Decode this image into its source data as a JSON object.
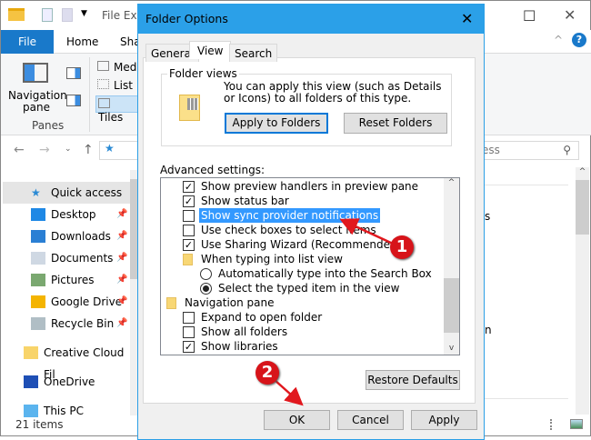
{
  "explorer": {
    "title": "File Exp",
    "ribbon_tabs": [
      "File",
      "Home",
      "Sha"
    ],
    "layout_items": [
      "Med",
      "List",
      "Tiles"
    ],
    "navigation_pane_label": "Navigation pane",
    "panes_label": "Panes",
    "search_placeholder": "ess",
    "nav_items": [
      {
        "label": "Quick access",
        "icon": "star-icon"
      },
      {
        "label": "Desktop",
        "icon": "desktop-icon",
        "pinned": true
      },
      {
        "label": "Downloads",
        "icon": "download-icon",
        "pinned": true
      },
      {
        "label": "Documents",
        "icon": "documents-icon",
        "pinned": true
      },
      {
        "label": "Pictures",
        "icon": "pictures-icon",
        "pinned": true
      },
      {
        "label": "Google Drive",
        "icon": "google-drive-icon",
        "pinned": true
      },
      {
        "label": "Recycle Bin",
        "icon": "recycle-bin-icon",
        "pinned": true
      },
      {
        "label": "Creative Cloud Fil",
        "icon": "creative-cloud-icon"
      },
      {
        "label": "OneDrive",
        "icon": "onedrive-icon"
      },
      {
        "label": "This PC",
        "icon": "pc-icon"
      }
    ],
    "content_fragments": [
      "s",
      "n"
    ],
    "status": "21 items"
  },
  "dialog": {
    "title": "Folder Options",
    "tabs": [
      "General",
      "View",
      "Search"
    ],
    "active_tab": "View",
    "folder_views": {
      "legend": "Folder views",
      "description": "You can apply this view (such as Details or Icons) to all folders of this type.",
      "apply_button": "Apply to Folders",
      "reset_button": "Reset Folders"
    },
    "advanced_label": "Advanced settings:",
    "settings": [
      {
        "label": "Show preview handlers in preview pane",
        "type": "checkbox",
        "checked": true,
        "indent": 1
      },
      {
        "label": "Show status bar",
        "type": "checkbox",
        "checked": true,
        "indent": 1
      },
      {
        "label": "Show sync provider notifications",
        "type": "checkbox",
        "checked": false,
        "indent": 1,
        "selected": true
      },
      {
        "label": "Use check boxes to select items",
        "type": "checkbox",
        "checked": false,
        "indent": 1
      },
      {
        "label": "Use Sharing Wizard (Recommended)",
        "type": "checkbox",
        "checked": true,
        "indent": 1
      },
      {
        "label": "When typing into list view",
        "type": "folder",
        "indent": 1
      },
      {
        "label": "Automatically type into the Search Box",
        "type": "radio",
        "checked": false,
        "indent": 2
      },
      {
        "label": "Select the typed item in the view",
        "type": "radio",
        "checked": true,
        "indent": 2
      },
      {
        "label": "Navigation pane",
        "type": "group",
        "indent": 0
      },
      {
        "label": "Expand to open folder",
        "type": "checkbox",
        "checked": false,
        "indent": 1
      },
      {
        "label": "Show all folders",
        "type": "checkbox",
        "checked": false,
        "indent": 1
      },
      {
        "label": "Show libraries",
        "type": "checkbox",
        "checked": true,
        "indent": 1
      }
    ],
    "restore_defaults": "Restore Defaults",
    "ok": "OK",
    "cancel": "Cancel",
    "apply": "Apply"
  },
  "annotations": [
    {
      "number": "1"
    },
    {
      "number": "2"
    }
  ],
  "colors": {
    "accent": "#2ba0e8",
    "file_tab": "#1979ca",
    "selection": "#3399ff",
    "badge": "#d7141a"
  }
}
